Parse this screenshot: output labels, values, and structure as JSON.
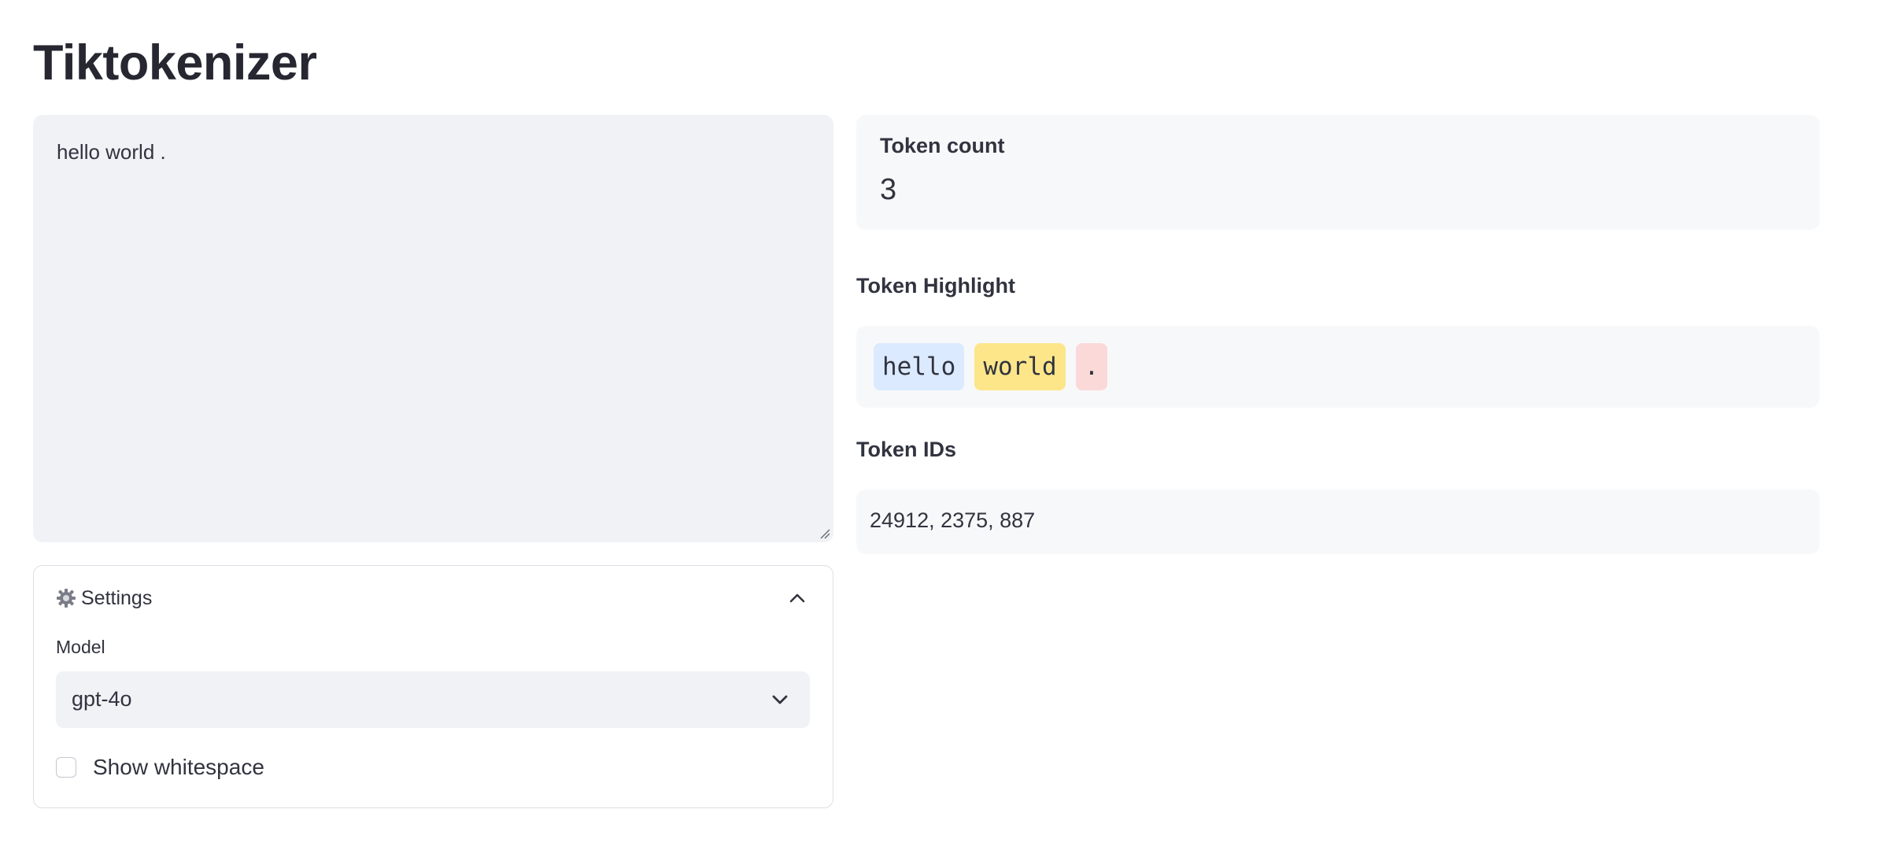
{
  "app": {
    "title": "Tiktokenizer"
  },
  "input": {
    "text": "hello world ."
  },
  "settings": {
    "header_label": "Settings",
    "header_icon": "gear-icon",
    "expanded": true,
    "model_label": "Model",
    "model_value": "gpt-4o",
    "show_whitespace_label": "Show whitespace",
    "show_whitespace_checked": false
  },
  "metrics": {
    "token_count_label": "Token count",
    "token_count_value": "3"
  },
  "highlight": {
    "label": "Token Highlight",
    "tokens": [
      {
        "text": "hello",
        "color": "#dbeafe"
      },
      {
        "text": "world",
        "color": "#fde68a"
      },
      {
        "text": ".",
        "color": "#fcd9d9"
      }
    ]
  },
  "token_ids": {
    "label": "Token IDs",
    "value": "24912, 2375, 887"
  }
}
